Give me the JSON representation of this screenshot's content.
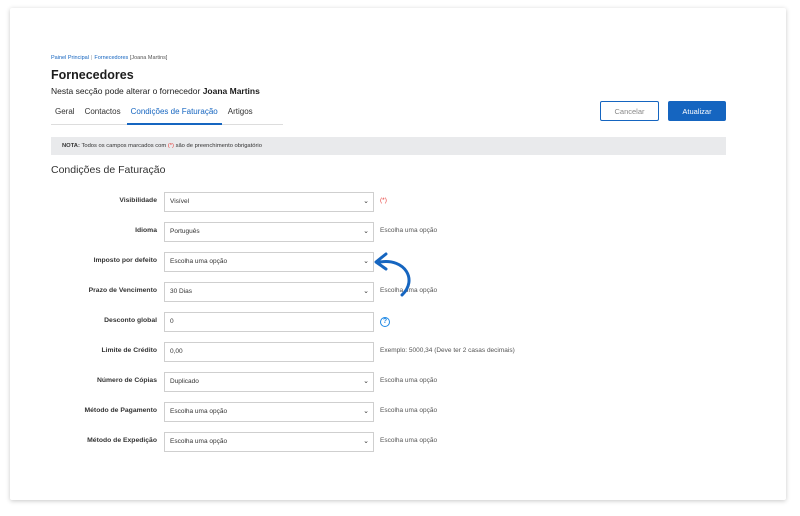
{
  "breadcrumb": {
    "home": "Painel Principal",
    "separator": "|",
    "current_link": "Fornecedores",
    "current_extra": "[Joana Martins]"
  },
  "header": {
    "title": "Fornecedores",
    "subtitle_prefix": "Nesta secção pode alterar o fornecedor",
    "subtitle_name": "Joana Martins"
  },
  "tabs": [
    {
      "label": "Geral"
    },
    {
      "label": "Contactos"
    },
    {
      "label": "Condições de Faturação"
    },
    {
      "label": "Artigos"
    }
  ],
  "buttons": {
    "cancel": "Cancelar",
    "update": "Atualizar"
  },
  "note": {
    "prefix": "NOTA:",
    "text1": "Todos os campos marcados com",
    "marker": "(*)",
    "text2": "são de preenchimento obrigatório"
  },
  "section_title": "Condições de Faturação",
  "form": [
    {
      "label": "Visibilidade",
      "value": "Visível",
      "type": "select",
      "hint": "(*)"
    },
    {
      "label": "Idioma",
      "value": "Português",
      "type": "select",
      "hint": "Escolha uma opção"
    },
    {
      "label": "Imposto por defeito",
      "value": "Escolha uma opção",
      "type": "select",
      "hint": ""
    },
    {
      "label": "Prazo de Vencimento",
      "value": "30 Dias",
      "type": "select",
      "hint": "Escolha uma opção"
    },
    {
      "label": "Desconto global",
      "value": "0",
      "type": "input",
      "hint": "?"
    },
    {
      "label": "Limite de Crédito",
      "value": "0,00",
      "type": "input",
      "hint": "Exemplo: 5000,34 (Deve ter 2 casas decimais)"
    },
    {
      "label": "Número de Cópias",
      "value": "Duplicado",
      "type": "select",
      "hint": "Escolha uma opção"
    },
    {
      "label": "Método de Pagamento",
      "value": "Escolha uma opção",
      "type": "select",
      "hint": "Escolha uma opção"
    },
    {
      "label": "Método de Expedição",
      "value": "Escolha uma opção",
      "type": "select",
      "hint": "Escolha uma opção"
    }
  ],
  "icons": {
    "chevron": "chevron-down-icon",
    "help": "help-circle-icon",
    "arrow": "curved-arrow-icon"
  },
  "colors": {
    "accent": "#1565c0",
    "required": "#e53935"
  }
}
